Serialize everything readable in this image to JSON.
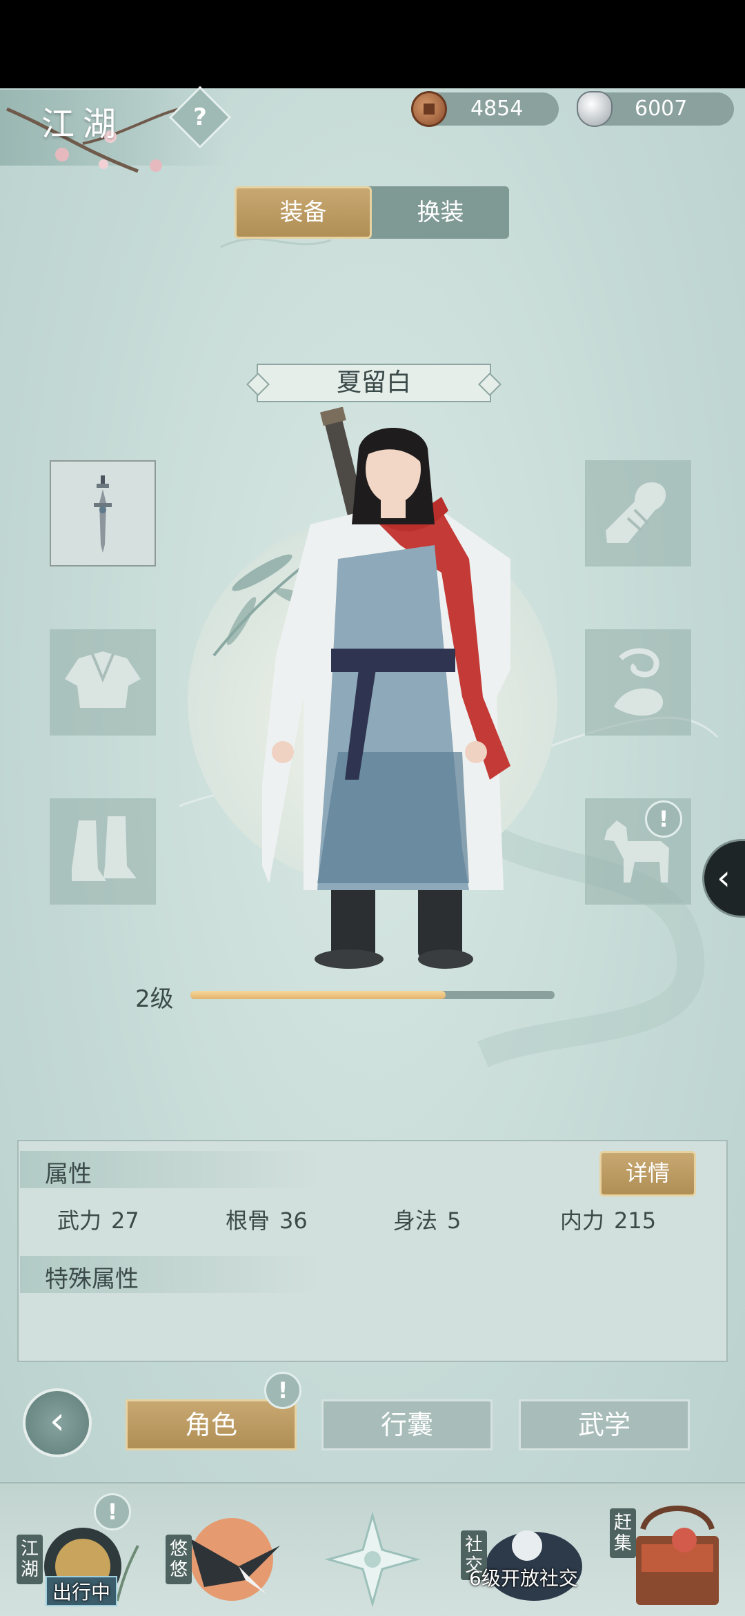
{
  "header": {
    "title": "江湖",
    "help_glyph": "?",
    "copper": "4854",
    "silver": "6007"
  },
  "tabs": {
    "equip": "装备",
    "outfit": "换装",
    "active": "equip"
  },
  "character": {
    "name": "夏留白",
    "level_label": "2级",
    "level_progress": 0.7
  },
  "equipment": {
    "left": [
      "sword-icon",
      "robe-icon",
      "boots-icon"
    ],
    "right": [
      "bracer-icon",
      "ornament-icon",
      "horse-icon"
    ],
    "alert_glyph": "!"
  },
  "attributes": {
    "heading": "属性",
    "detail_button": "详情",
    "stats": [
      {
        "label": "武力",
        "value": "27"
      },
      {
        "label": "根骨",
        "value": "36"
      },
      {
        "label": "身法",
        "value": "5"
      },
      {
        "label": "内力",
        "value": "215"
      }
    ],
    "special_heading": "特殊属性"
  },
  "bottom_tabs": {
    "role": "角色",
    "bag": "行囊",
    "martial": "武学",
    "active": "role"
  },
  "dock": {
    "jianghu": "江湖",
    "traveling": "出行中",
    "youyou": "悠悠",
    "social": "社交",
    "social_locked": "6级开放社交",
    "market": "赶集"
  },
  "colors": {
    "gold": "#b08f55",
    "panel": "#d2e0dd",
    "bar_fill": "#e3b46d"
  }
}
